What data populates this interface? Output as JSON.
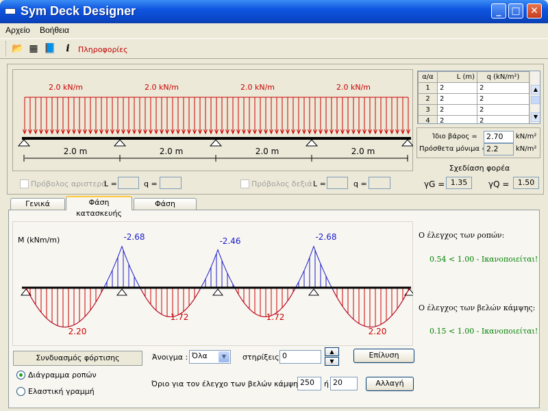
{
  "window": {
    "title": "Sym Deck Designer"
  },
  "menu": {
    "items": [
      "Αρχείο",
      "Βοήθεια"
    ]
  },
  "toolbar": {
    "info_label": "Πληροφορίες",
    "icons": [
      "open-folder-icon",
      "calculator-icon",
      "book-icon",
      "info-icon"
    ]
  },
  "beam": {
    "loads": [
      "2.0 kN/m",
      "2.0 kN/m",
      "2.0 kN/m",
      "2.0 kN/m"
    ],
    "spans": [
      "2.0 m",
      "2.0 m",
      "2.0 m",
      "2.0 m"
    ],
    "load_color": "#cc0000"
  },
  "cantilever": {
    "left_label": "Πρόβολος αριστερά",
    "right_label": "Πρόβολος δεξιά",
    "L_label": "L =",
    "q_label": "q =",
    "left_L": "",
    "left_q": "",
    "right_L": "",
    "right_q": ""
  },
  "span_table": {
    "headers": [
      "α/α",
      "L (m)",
      "q (kN/m²)"
    ],
    "rows": [
      [
        "1",
        "2",
        "2"
      ],
      [
        "2",
        "2",
        "2"
      ],
      [
        "3",
        "2",
        "2"
      ],
      [
        "4",
        "2",
        "2"
      ]
    ]
  },
  "weights": {
    "self_label": "Ίδιο βάρος =",
    "self_value": "2.70",
    "self_unit": "kN/m²",
    "extra_label": "Πρόσθετα μόνιμα =",
    "extra_value": "2.2",
    "extra_unit": "kN/m²"
  },
  "design_button": "Σχεδίαση φορέα",
  "factors": {
    "gG_label": "γG =",
    "gG_value": "1.35",
    "gQ_label": "γQ =",
    "gQ_value": "1.50"
  },
  "tabs": [
    {
      "label": "Γενικά στοιχεία",
      "active": false
    },
    {
      "label": "Φάση κατασκευής",
      "active": true
    },
    {
      "label": "Φάση λειτουργίας",
      "active": false
    }
  ],
  "moment_diagram": {
    "axis_label": "M (kNm/m)",
    "support_moments": [
      "-2.68",
      "-2.46",
      "-2.68"
    ],
    "span_moments": [
      "2.20",
      "1.72",
      "1.72",
      "2.20"
    ],
    "negative_color": "#1a1acc",
    "positive_color": "#cc0000"
  },
  "checks": {
    "moment_title": "Ο έλεγχος των ροπών:",
    "moment_result": "0.54 < 1.00 - Ικανοποιείται!",
    "deflection_title": "Ο έλεγχος των βελών κάμψης:",
    "deflection_result": "0.15 < 1.00 - Ικανοποιείται!"
  },
  "controls": {
    "combo_button": "Συνδυασμός φόρτισης",
    "radio_moment": "Διάγραμμα ροπών",
    "radio_elastic": "Ελαστική γραμμή",
    "opening_label": "Άνοιγμα :",
    "opening_value": "Όλα",
    "supports_label": "στηρίξεις :",
    "supports_value": "0",
    "solve_button": "Επίλυση",
    "limit_label": "Όριο για τον έλεγχο των βελών κάμψης: ...",
    "limit_value1": "250",
    "limit_or": "ή",
    "limit_value2": "20",
    "change_button": "Αλλαγή"
  }
}
